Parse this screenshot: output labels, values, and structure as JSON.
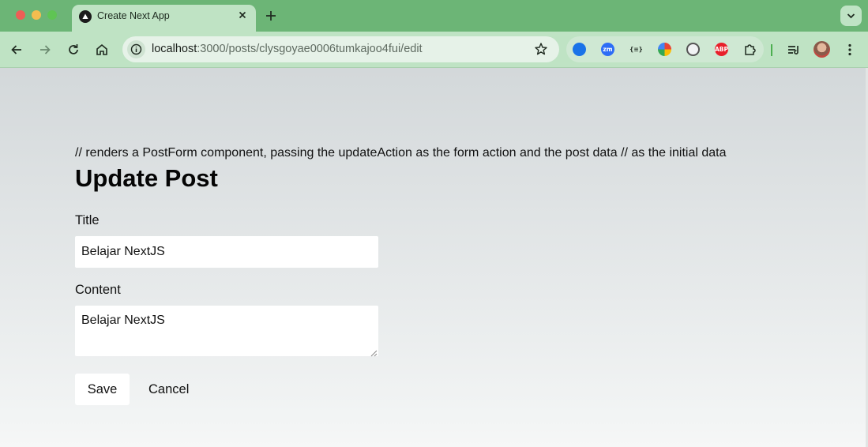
{
  "browser": {
    "tab_title": "Create Next App",
    "url_host": "localhost",
    "url_rest": ":3000/posts/clysgoyae0006tumkajoo4fui/edit",
    "extensions": [
      {
        "name": "sync-extension-icon",
        "color": "#1a73e8",
        "label": ""
      },
      {
        "name": "zoom-extension-icon",
        "color": "#2d6df6",
        "label": "zm"
      },
      {
        "name": "json-viewer-icon",
        "color": "#3b4a3d",
        "label": "{≡}"
      },
      {
        "name": "color-picker-icon",
        "color": "#e94235",
        "label": ""
      },
      {
        "name": "tab-manager-icon",
        "color": "#555555",
        "label": ""
      },
      {
        "name": "adblock-plus-icon",
        "color": "#e8202a",
        "label": "ABP"
      }
    ]
  },
  "page": {
    "comment": "// renders a PostForm component, passing the updateAction as the form action and the post data // as the initial data",
    "title": "Update Post",
    "title_label": "Title",
    "title_value": "Belajar NextJS",
    "content_label": "Content",
    "content_value": "Belajar NextJS",
    "save_label": "Save",
    "cancel_label": "Cancel"
  }
}
